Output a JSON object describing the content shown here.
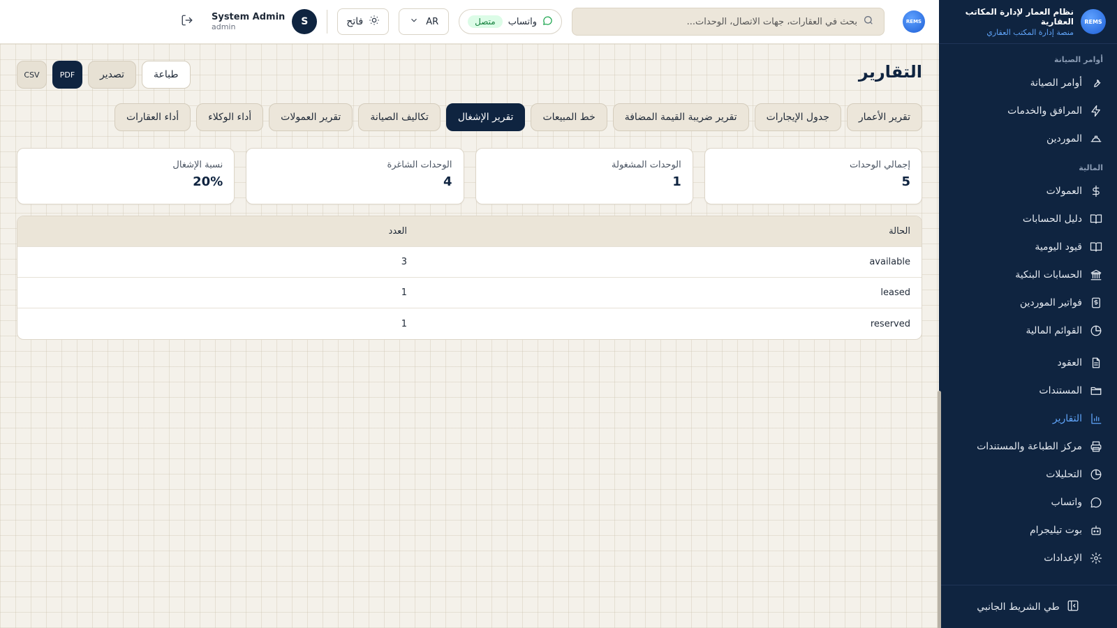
{
  "brand": {
    "name": "نظام العمار لإدارة المكاتب العقارية",
    "subtitle": "منصة إدارة المكتب العقاري",
    "logo_text": "REMS"
  },
  "sidebar": {
    "sections": [
      {
        "title": "أوامر الصيانة",
        "items": [
          {
            "label": "أوامر الصيانة",
            "icon": "wrench-icon"
          },
          {
            "label": "المرافق والخدمات",
            "icon": "lightning-icon"
          },
          {
            "label": "الموردين",
            "icon": "hard-hat-icon"
          }
        ]
      },
      {
        "title": "المالية",
        "items": [
          {
            "label": "العمولات",
            "icon": "dollar-icon"
          },
          {
            "label": "دليل الحسابات",
            "icon": "book-icon"
          },
          {
            "label": "قيود اليومية",
            "icon": "book-open-icon"
          },
          {
            "label": "الحسابات البنكية",
            "icon": "bank-icon"
          },
          {
            "label": "فواتير الموردين",
            "icon": "invoice-icon"
          },
          {
            "label": "القوائم المالية",
            "icon": "pie-chart-icon"
          }
        ]
      }
    ],
    "items_more": [
      {
        "label": "العقود",
        "icon": "document-icon"
      },
      {
        "label": "المستندات",
        "icon": "folder-icon"
      },
      {
        "label": "التقارير",
        "icon": "bar-chart-icon",
        "active": true
      },
      {
        "label": "مركز الطباعة والمستندات",
        "icon": "printer-icon"
      },
      {
        "label": "التحليلات",
        "icon": "analytics-icon"
      },
      {
        "label": "واتساب",
        "icon": "chat-icon"
      },
      {
        "label": "بوت تيليجرام",
        "icon": "bot-icon"
      },
      {
        "label": "الإعدادات",
        "icon": "gear-icon"
      }
    ],
    "collapse_label": "طي الشريط الجانبي"
  },
  "header": {
    "search_placeholder": "بحث في العقارات، جهات الاتصال، الوحدات...",
    "whatsapp_label": "واتساب",
    "whatsapp_status": "متصل",
    "language": "AR",
    "theme_label": "فاتح",
    "user": {
      "initial": "S",
      "name": "System Admin",
      "role": "admin"
    }
  },
  "page": {
    "title": "التقارير",
    "actions": {
      "print": "طباعة",
      "export": "تصدير",
      "pdf": "PDF",
      "csv": "CSV"
    },
    "tabs": [
      {
        "label": "تقرير الأعمار"
      },
      {
        "label": "جدول الإيجارات"
      },
      {
        "label": "تقرير ضريبة القيمة المضافة"
      },
      {
        "label": "خط المبيعات"
      },
      {
        "label": "تقرير الإشغال",
        "active": true
      },
      {
        "label": "تكاليف الصيانة"
      },
      {
        "label": "تقرير العمولات"
      },
      {
        "label": "أداء الوكلاء"
      },
      {
        "label": "أداء العقارات"
      }
    ],
    "stats": [
      {
        "label": "إجمالي الوحدات",
        "value": "5"
      },
      {
        "label": "الوحدات المشغولة",
        "value": "1"
      },
      {
        "label": "الوحدات الشاغرة",
        "value": "4"
      },
      {
        "label": "نسبة الإشغال",
        "value": "20%"
      }
    ],
    "table": {
      "headers": {
        "status": "الحالة",
        "count": "العدد"
      },
      "rows": [
        {
          "status": "available",
          "count": "3"
        },
        {
          "status": "leased",
          "count": "1"
        },
        {
          "status": "reserved",
          "count": "1"
        }
      ]
    }
  },
  "colors": {
    "sidebar_bg": "#0f2440",
    "accent": "#60a5fa",
    "active_tab": "#0f2440",
    "background": "#f4f1ea",
    "status_ok": "#15803d"
  }
}
